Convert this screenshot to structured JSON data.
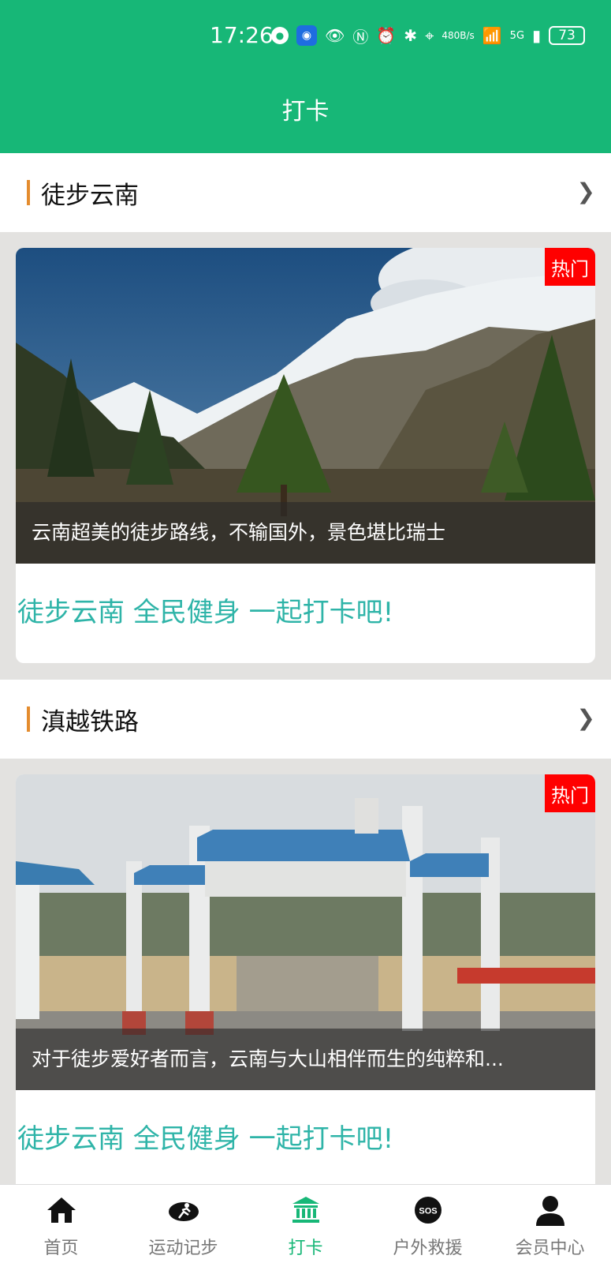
{
  "status_bar": {
    "time": "17:26",
    "speed_value": "480",
    "speed_unit": "B/s",
    "network": "5G",
    "battery": "73"
  },
  "header": {
    "title": "打卡"
  },
  "sections": [
    {
      "name": "徒步云南",
      "badge": "热门",
      "caption": "云南超美的徒步路线，不输国外，景色堪比瑞士",
      "slogan": "徒步云南 全民健身 一起打卡吧!"
    },
    {
      "name": "滇越铁路",
      "badge": "热门",
      "caption": "对于徒步爱好者而言，云南与大山相伴而生的纯粹和...",
      "slogan": "徒步云南 全民健身 一起打卡吧!"
    }
  ],
  "tabbar": {
    "items": [
      {
        "label": "首页",
        "icon": "home-icon"
      },
      {
        "label": "运动记步",
        "icon": "running-icon"
      },
      {
        "label": "打卡",
        "icon": "landmark-icon",
        "active": true
      },
      {
        "label": "户外救援",
        "icon": "sos-icon"
      },
      {
        "label": "会员中心",
        "icon": "user-icon"
      }
    ]
  },
  "colors": {
    "primary": "#17b777",
    "accent_bar": "#e48c2e",
    "hot_badge": "#ff0000",
    "slogan": "#2fb4a8"
  }
}
